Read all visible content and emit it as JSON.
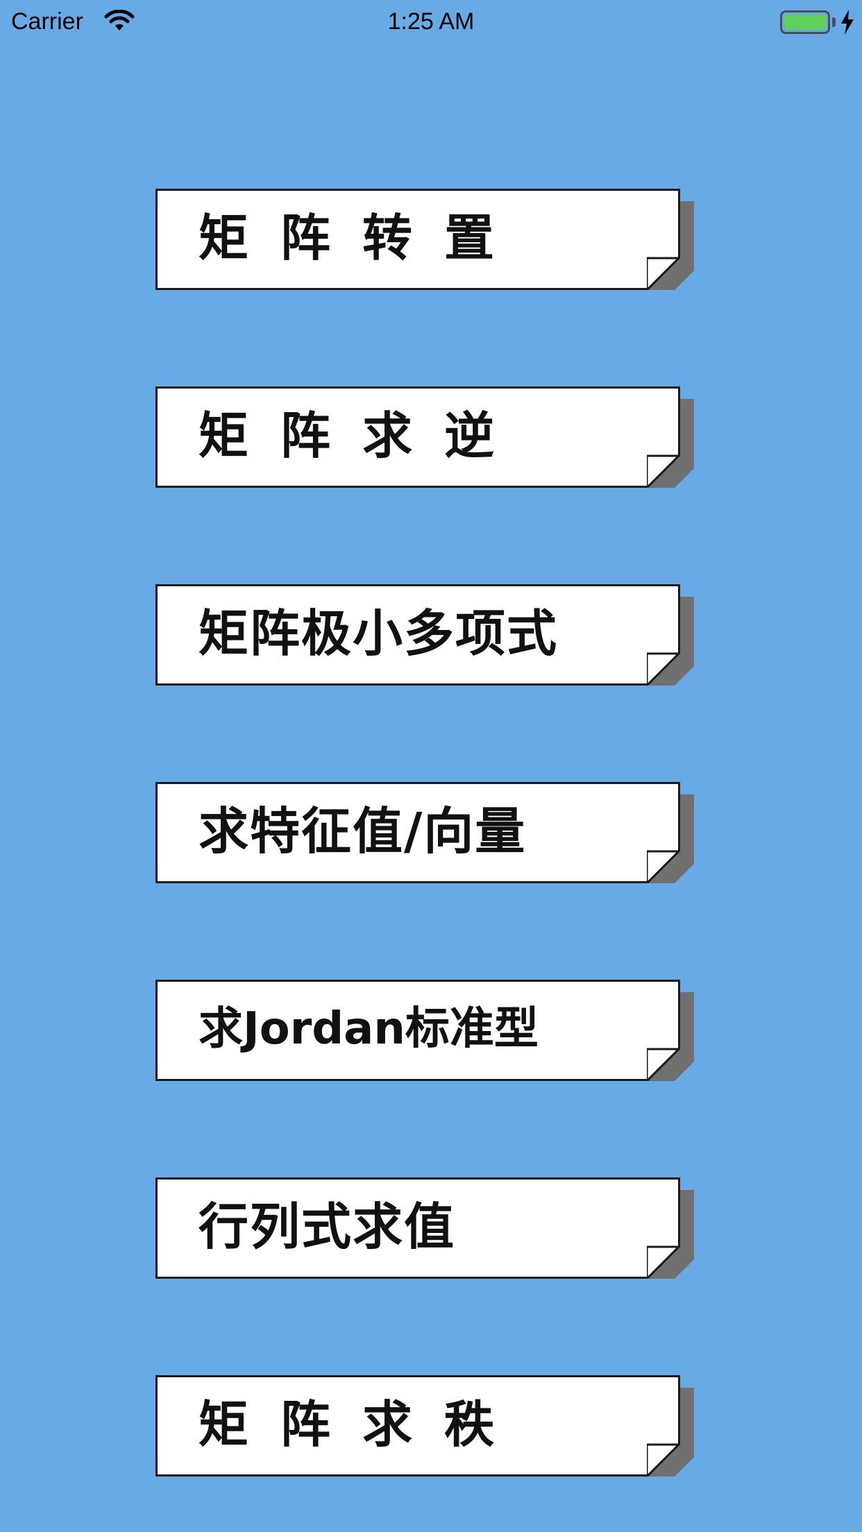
{
  "status_bar": {
    "carrier": "Carrier",
    "time": "1:25 AM",
    "battery_level": 1.0,
    "charging": true,
    "icons": {
      "wifi": "wifi-icon",
      "battery": "battery-icon",
      "charging": "charging-bolt-icon"
    }
  },
  "colors": {
    "background": "#67aae6",
    "card": "#ffffff",
    "card_border": "#1a1a1a",
    "card_shadow": "#707071",
    "battery_fill": "#5fd05c"
  },
  "menu": {
    "items": [
      {
        "label": "矩阵转置"
      },
      {
        "label": "矩阵求逆"
      },
      {
        "label": "矩阵极小多项式"
      },
      {
        "label": "求特征值/向量"
      },
      {
        "label": "求Jordan标准型"
      },
      {
        "label": "行列式求值"
      },
      {
        "label": "矩阵求秩"
      }
    ]
  }
}
